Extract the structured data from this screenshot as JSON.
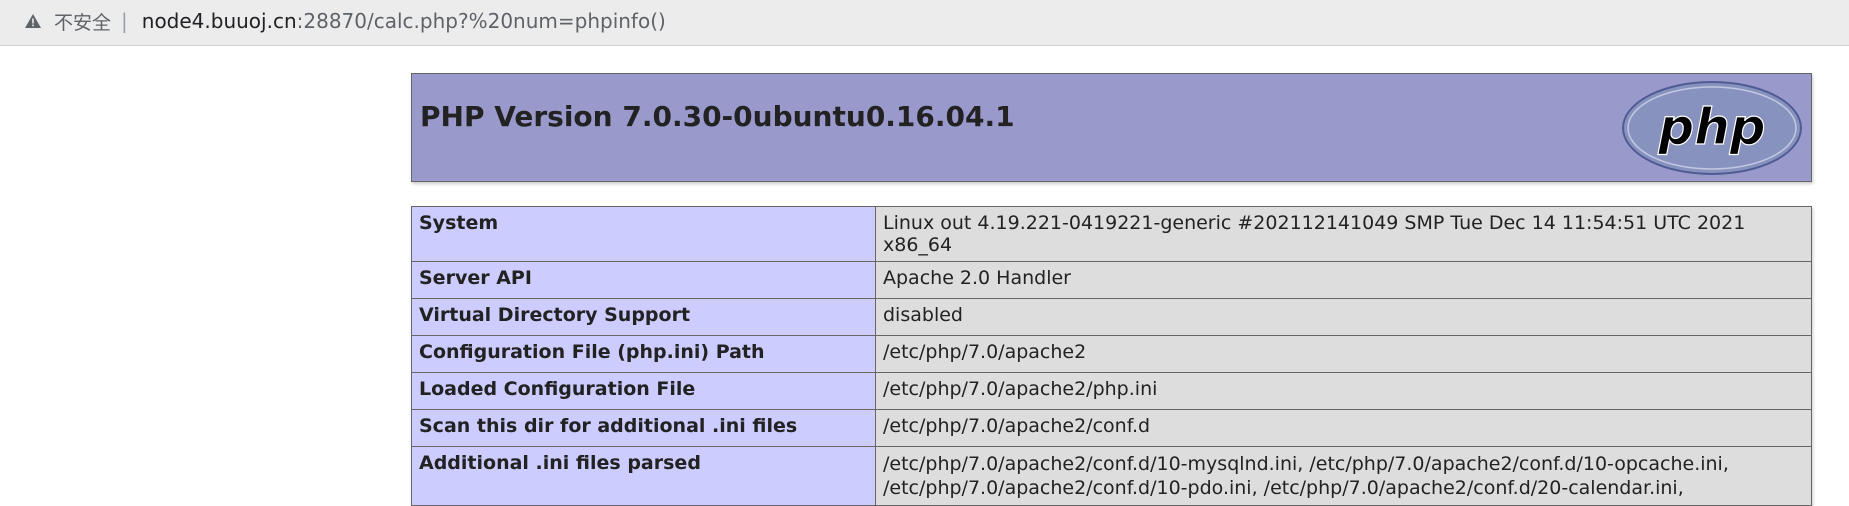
{
  "browser": {
    "security_label": "不安全",
    "separator": "|",
    "url_host": "node4.buuoj.cn",
    "url_rest": ":28870/calc.php?%20num=phpinfo()"
  },
  "phpinfo": {
    "title": "PHP Version 7.0.30-0ubuntu0.16.04.1",
    "logo_text": "php",
    "rows": [
      {
        "key": "System",
        "value": "Linux out 4.19.221-0419221-generic #202112141049 SMP Tue Dec 14 11:54:51 UTC 2021 x86_64"
      },
      {
        "key": "Server API",
        "value": "Apache 2.0 Handler"
      },
      {
        "key": "Virtual Directory Support",
        "value": "disabled"
      },
      {
        "key": "Configuration File (php.ini) Path",
        "value": "/etc/php/7.0/apache2"
      },
      {
        "key": "Loaded Configuration File",
        "value": "/etc/php/7.0/apache2/php.ini"
      },
      {
        "key": "Scan this dir for additional .ini files",
        "value": "/etc/php/7.0/apache2/conf.d"
      },
      {
        "key": "Additional .ini files parsed",
        "value_line1": "/etc/php/7.0/apache2/conf.d/10-mysqlnd.ini, /etc/php/7.0/apache2/conf.d/10-opcache.ini,",
        "value_line2": "/etc/php/7.0/apache2/conf.d/10-pdo.ini, /etc/php/7.0/apache2/conf.d/20-calendar.ini,"
      }
    ]
  }
}
